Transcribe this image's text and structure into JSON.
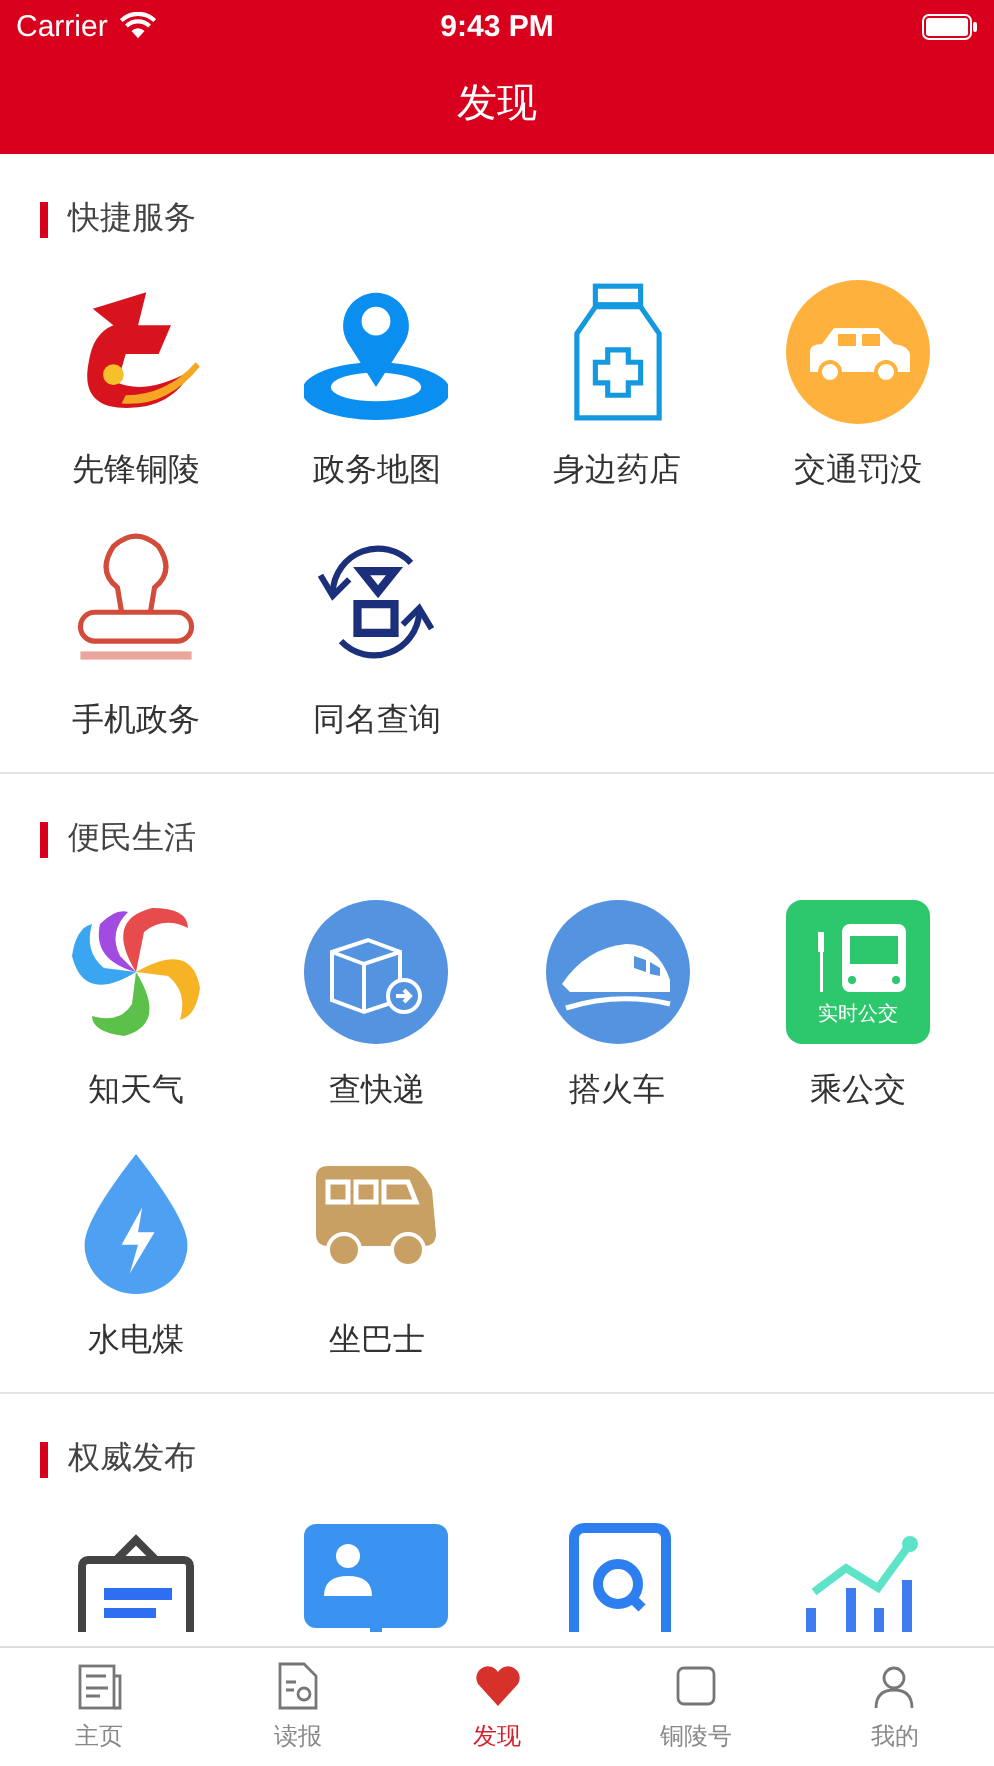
{
  "status_bar": {
    "carrier": "Carrier",
    "time": "9:43 PM"
  },
  "header": {
    "title": "发现"
  },
  "sections": [
    {
      "title": "快捷服务",
      "items": [
        {
          "kind": "labeled",
          "label": "先锋铜陵"
        },
        {
          "kind": "labeled",
          "label": "政务地图"
        },
        {
          "kind": "labeled",
          "label": "身边药店"
        },
        {
          "kind": "labeled",
          "label": "交通罚没"
        },
        {
          "kind": "labeled",
          "label": "手机政务"
        },
        {
          "kind": "labeled",
          "label": "同名查询"
        }
      ]
    },
    {
      "title": "便民生活",
      "items": [
        {
          "kind": "labeled",
          "label": "知天气"
        },
        {
          "kind": "labeled",
          "label": "查快递"
        },
        {
          "kind": "labeled",
          "label": "搭火车"
        },
        {
          "kind": "labeled",
          "label": "乘公交",
          "icon_text": "实时公交"
        },
        {
          "kind": "labeled",
          "label": "水电煤"
        },
        {
          "kind": "labeled",
          "label": "坐巴士"
        }
      ]
    },
    {
      "title": "权威发布",
      "items": [
        {
          "kind": "unlabeled"
        },
        {
          "kind": "unlabeled"
        },
        {
          "kind": "unlabeled"
        },
        {
          "kind": "unlabeled"
        }
      ]
    }
  ],
  "tab_bar": [
    {
      "label": "主页",
      "selected": false
    },
    {
      "label": "读报",
      "selected": false
    },
    {
      "label": "发现",
      "selected": true
    },
    {
      "label": "铜陵号",
      "selected": false
    },
    {
      "label": "我的",
      "selected": false
    }
  ]
}
